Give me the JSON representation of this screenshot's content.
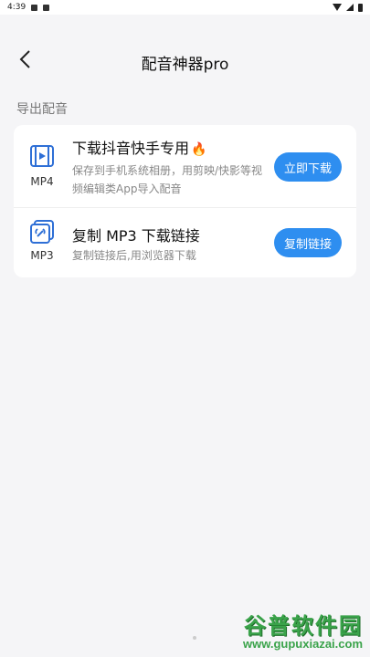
{
  "status_bar": {
    "time": "4:39"
  },
  "header": {
    "title": "配音神器pro"
  },
  "section": {
    "label": "导出配音"
  },
  "items": [
    {
      "format": "MP4",
      "title": "下载抖音快手专用",
      "title_emoji": "🔥",
      "description": "保存到手机系统相册，用剪映/快影等视频编辑类App导入配音",
      "button_label": "立即下载",
      "icon": "video-file-icon"
    },
    {
      "format": "MP3",
      "title": "复制 MP3 下载链接",
      "description": "复制链接后,用浏览器下载",
      "button_label": "复制链接",
      "icon": "link-file-icon"
    }
  ],
  "watermark": {
    "name": "谷普软件园",
    "url": "www.gupuxiazai.com"
  },
  "colors": {
    "accent": "#2e8ef0",
    "background": "#f5f5f7",
    "watermark": "#3aa34a"
  }
}
